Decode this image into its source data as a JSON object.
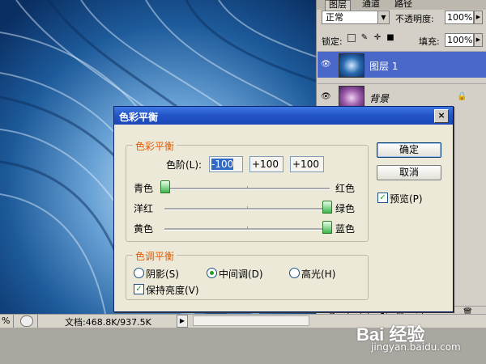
{
  "status_bar": {
    "zoom_partial": "%",
    "doc_info": "文档:468.8K/937.5K",
    "arrow": "▶"
  },
  "layers_panel": {
    "tabs": [
      "图层",
      "通道",
      "路径"
    ],
    "blend_mode": "正常",
    "opacity_label": "不透明度:",
    "opacity_value": "100%",
    "lock_label": "锁定:",
    "fill_label": "填充:",
    "fill_value": "100%",
    "layers": [
      {
        "name": "图层 1",
        "selected": true
      },
      {
        "name": "背景",
        "selected": false
      }
    ]
  },
  "dialog": {
    "title": "色彩平衡",
    "close_label": "×",
    "color_balance_group": "色彩平衡",
    "levels_label": "色阶(L):",
    "levels_values": [
      "-100",
      "+100",
      "+100"
    ],
    "sliders": [
      {
        "left": "青色",
        "right": "红色",
        "value": -100
      },
      {
        "left": "洋红",
        "right": "绿色",
        "value": 100
      },
      {
        "left": "黄色",
        "right": "蓝色",
        "value": 100
      }
    ],
    "tone_group": "色调平衡",
    "tone_options": [
      "阴影(S)",
      "中间调(D)",
      "高光(H)"
    ],
    "tone_selected": 1,
    "preserve_luminosity": "保持亮度(V)",
    "preserve_checked": true,
    "ok_label": "确定",
    "cancel_label": "取消",
    "preview_label": "预览(P)",
    "preview_checked": true
  },
  "watermark": {
    "brand": "Bai 经验",
    "url": "jingyan.baidu.com"
  },
  "colors": {
    "title_bar": "#2456c7",
    "legend": "#e05a00",
    "selected_layer": "#4a68c8",
    "slider_thumb": "#3cb54a"
  }
}
